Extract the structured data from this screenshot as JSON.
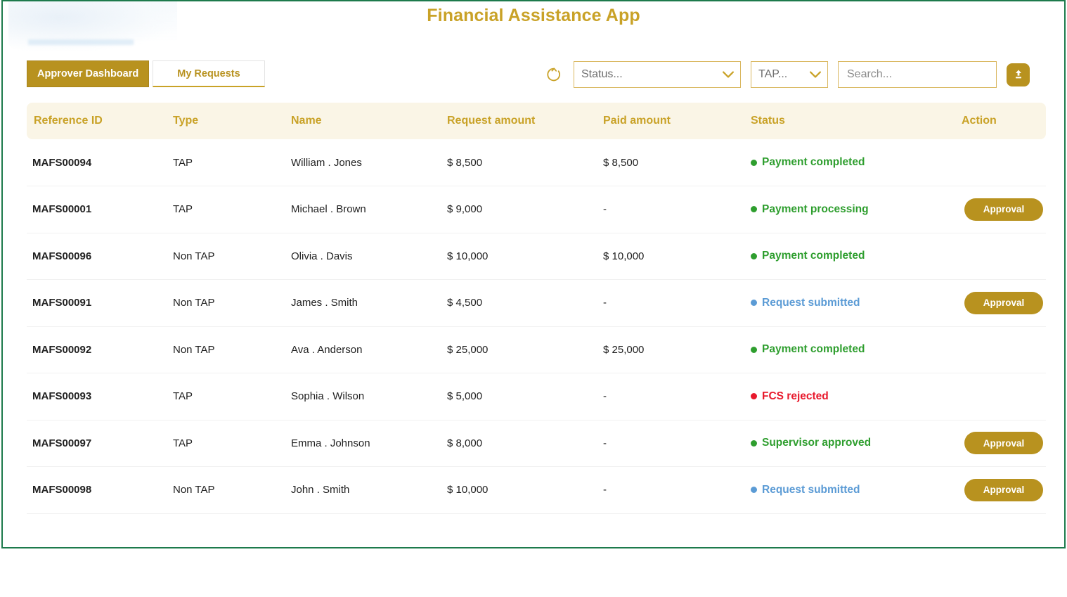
{
  "app": {
    "title": "Financial Assistance App",
    "accent_gold": "#b8921f",
    "title_gold": "#c9a227",
    "frame_green": "#1d7a4c",
    "header_bg": "#faf5e6"
  },
  "tabs": [
    {
      "label": "Approver Dashboard",
      "active": true
    },
    {
      "label": "My Requests",
      "active": false
    }
  ],
  "toolbar": {
    "refresh_icon": "refresh-icon",
    "status_filter": {
      "label": "Status...",
      "icon": "chevron-down-icon"
    },
    "type_filter": {
      "label": "TAP...",
      "icon": "chevron-down-icon"
    },
    "search": {
      "value": "",
      "placeholder": "Search..."
    },
    "upload_button": {
      "icon": "upload-icon",
      "label": ""
    }
  },
  "table": {
    "columns": [
      "Reference ID",
      "Type",
      "Name",
      "Request amount",
      "Paid amount",
      "Status",
      "Action"
    ],
    "rows": [
      {
        "reference_id": "MAFS00094",
        "type": "TAP",
        "name": "William . Jones",
        "request_amount": "$ 8,500",
        "paid_amount": "$ 8,500",
        "status": "Payment completed",
        "status_color": "#2e9e2e",
        "action": ""
      },
      {
        "reference_id": "MAFS00001",
        "type": "TAP",
        "name": "Michael  . Brown",
        "request_amount": "$ 9,000",
        "paid_amount": "-",
        "status": "Payment processing",
        "status_color": "#2e9e2e",
        "action": "Approval"
      },
      {
        "reference_id": "MAFS00096",
        "type": "Non TAP",
        "name": "Olivia  . Davis",
        "request_amount": "$ 10,000",
        "paid_amount": "$ 10,000",
        "status": "Payment completed",
        "status_color": "#2e9e2e",
        "action": ""
      },
      {
        "reference_id": "MAFS00091",
        "type": "Non TAP",
        "name": "James . Smith",
        "request_amount": "$ 4,500",
        "paid_amount": "-",
        "status": "Request submitted",
        "status_color": "#5b9bd5",
        "action": "Approval"
      },
      {
        "reference_id": "MAFS00092",
        "type": "Non TAP",
        "name": "Ava . Anderson",
        "request_amount": "$ 25,000",
        "paid_amount": "$ 25,000",
        "status": "Payment completed",
        "status_color": "#2e9e2e",
        "action": ""
      },
      {
        "reference_id": "MAFS00093",
        "type": "TAP",
        "name": "Sophia . Wilson",
        "request_amount": "$ 5,000",
        "paid_amount": "-",
        "status": "FCS rejected",
        "status_color": "#e8192c",
        "action": ""
      },
      {
        "reference_id": "MAFS00097",
        "type": "TAP",
        "name": "Emma . Johnson",
        "request_amount": "$ 8,000",
        "paid_amount": "-",
        "status": "Supervisor approved",
        "status_color": "#2e9e2e",
        "action": "Approval"
      },
      {
        "reference_id": "MAFS00098",
        "type": "Non TAP",
        "name": "John . Smith",
        "request_amount": "$ 10,000",
        "paid_amount": "-",
        "status": "Request submitted",
        "status_color": "#5b9bd5",
        "action": "Approval"
      }
    ]
  }
}
